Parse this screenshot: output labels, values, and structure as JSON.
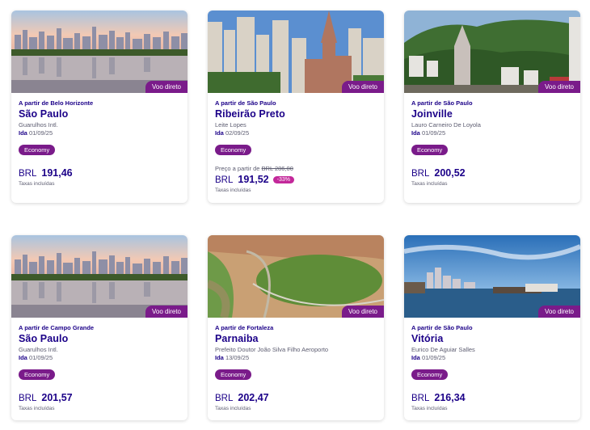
{
  "cards": [
    {
      "badge": "Voo direto",
      "from": "A partir de Belo Horizonte",
      "city": "São Paulo",
      "airport": "Guarulhos Intl.",
      "date_label": "Ida",
      "date": "01/09/25",
      "cabin": "Economy",
      "currency": "BRL",
      "price": "191,46",
      "taxes": "Taxas incluídas",
      "photo": "sao-paulo-skyline"
    },
    {
      "badge": "Voo direto",
      "from": "A partir de São Paulo",
      "city": "Ribeirão Preto",
      "airport": "Leite Lopes",
      "date_label": "Ida",
      "date": "02/09/25",
      "cabin": "Economy",
      "original_label": "Preço a partir de",
      "original_price": "BRL 286,00",
      "currency": "BRL",
      "price": "191,52",
      "discount": "-33%",
      "taxes": "Taxas incluídas",
      "photo": "ribeirao-preto-cathedral"
    },
    {
      "badge": "Voo direto",
      "from": "A partir de São Paulo",
      "city": "Joinville",
      "airport": "Lauro Carneiro De Loyola",
      "date_label": "Ida",
      "date": "01/09/25",
      "cabin": "Economy",
      "currency": "BRL",
      "price": "200,52",
      "taxes": "Taxas incluídas",
      "photo": "joinville-hills"
    },
    {
      "badge": "Voo direto",
      "from": "A partir de Campo Grande",
      "city": "São Paulo",
      "airport": "Guarulhos Intl.",
      "date_label": "Ida",
      "date": "01/09/25",
      "cabin": "Economy",
      "currency": "BRL",
      "price": "201,57",
      "taxes": "Taxas incluídas",
      "photo": "sao-paulo-skyline"
    },
    {
      "badge": "Voo direto",
      "from": "A partir de Fortaleza",
      "city": "Parnaiba",
      "airport": "Prefeito Doutor João Silva Filho Aeroporto",
      "date_label": "Ida",
      "date": "13/09/25",
      "cabin": "Economy",
      "currency": "BRL",
      "price": "202,47",
      "taxes": "Taxas incluídas",
      "photo": "parnaiba-river-aerial"
    },
    {
      "badge": "Voo direto",
      "from": "A partir de São Paulo",
      "city": "Vitória",
      "airport": "Eurico De Aguiar Salles",
      "date_label": "Ida",
      "date": "01/09/25",
      "cabin": "Economy",
      "currency": "BRL",
      "price": "216,34",
      "taxes": "Taxas incluídas",
      "photo": "vitoria-harbor"
    }
  ]
}
